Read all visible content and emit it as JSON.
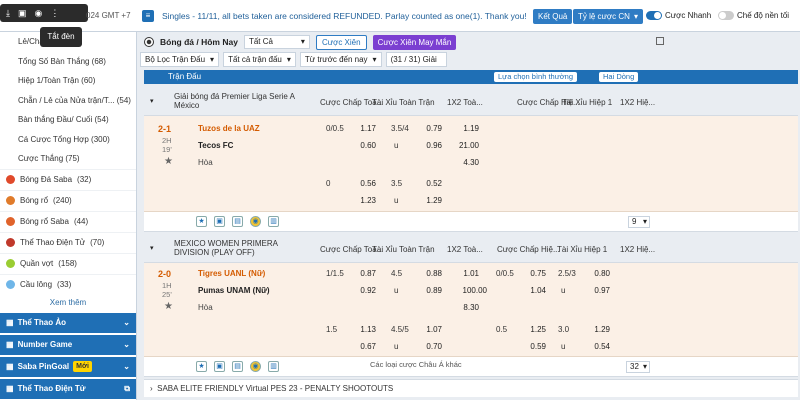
{
  "top": {
    "time": "024 GMT +7",
    "tooltip": "Tắt đèn",
    "announcement": "Singles - 11/11, all bets taken are considered REFUNDED. Parlay counted as one(1). Thank you!",
    "result_button": "Kết Quả",
    "odds_type": "Tỷ lệ cược CN",
    "quick_bet": "Cược Nhanh",
    "simple_mode": "Chế độ nền tối"
  },
  "sidebar": {
    "sub_items": [
      "Lẻ/Chẵn",
      "Tổng Số Bàn Thắng (68)",
      "Hiệp 1/Toàn Trận (60)",
      "Chẵn / Lẻ của Nửa trận/T... (54)",
      "Bàn thắng Đầu/ Cuối (54)",
      "Cá Cược Tổng Hợp (300)",
      "Cược Thắng (75)"
    ],
    "sports": [
      {
        "label": "Bóng Đá Saba",
        "count": "(32)",
        "color": "#e04a2b"
      },
      {
        "label": "Bóng rổ",
        "count": "(240)",
        "color": "#e07b2b"
      },
      {
        "label": "Bóng rổ Saba",
        "count": "(44)",
        "color": "#e0632b"
      },
      {
        "label": "Thể Thao Điện Tử",
        "count": "(70)",
        "color": "#c0392b"
      },
      {
        "label": "Quần vợt",
        "count": "(158)",
        "color": "#9acd32"
      },
      {
        "label": "Cầu lông",
        "count": "(33)",
        "color": "#6fb6e8"
      }
    ],
    "more": "Xem thêm",
    "sections": [
      "Thể Thao Ảo",
      "Number Game",
      "Saba PinGoal",
      "Thể Thao Điện Tử"
    ],
    "new_badge": "Mới"
  },
  "filters": {
    "title": "Bóng đá / Hôm Nay",
    "all": "Tất Cả",
    "single_bet": "Cược Xiên",
    "lucky_bet": "Cược Xiên May Mắn",
    "league_filter": "Bộ Lọc Trận Đấu",
    "all_matches": "Tất cả trận đấu",
    "sort": "Từ trước đến nay",
    "league_count": "(31 / 31) Giải"
  },
  "header": {
    "label": "Trận Đấu",
    "sort_option": "Lựa chọn bình thường",
    "lines": "Hai Dòng"
  },
  "columns": [
    "Cược Chấp Toà...",
    "Tài Xỉu Toàn Trận",
    "1X2 Toà...",
    "Cược Chấp Hiệ...",
    "Tài Xỉu Hiệp 1",
    "1X2 Hiệ..."
  ],
  "match1": {
    "league": "Giải bóng đá Premier Liga Serie A México",
    "score": "2-1",
    "half": "2H",
    "minute": "19'",
    "home": "Tuzos de la UAZ",
    "away": "Tecos FC",
    "draw": "Hòa",
    "rows": [
      {
        "hdp": "0/0.5",
        "hdp_h": "1.17",
        "ou": "3.5/4",
        "ou_h": "0.79",
        "x12": "1.19"
      },
      {
        "hdp_a": "0.60",
        "ou_u": "u",
        "ou_a": "0.96",
        "x12": "21.00"
      },
      {
        "x12": "4.30"
      },
      {
        "hdp": "0",
        "hdp_h": "0.56",
        "ou": "3.5",
        "ou_h": "0.52"
      },
      {
        "hdp_a": "1.23",
        "ou_u": "u",
        "ou_a": "1.29"
      }
    ],
    "count": "9"
  },
  "match2": {
    "league": "MEXICO WOMEN PRIMERA DIVISION (PLAY OFF)",
    "score": "2-0",
    "half": "1H",
    "minute": "25'",
    "home": "Tigres UANL (Nữ)",
    "away": "Pumas UNAM (Nữ)",
    "draw": "Hòa",
    "rows": [
      {
        "hdp": "1/1.5",
        "hdp_h": "0.87",
        "ou": "4.5",
        "ou_h": "0.88",
        "x12": "1.01",
        "h1_hdp": "0/0.5",
        "h1_hdp_h": "0.75",
        "h1_ou": "2.5/3",
        "h1_ou_h": "0.80"
      },
      {
        "hdp_a": "0.92",
        "ou_u": "u",
        "ou_a": "0.89",
        "x12": "100.00",
        "h1_hdp_a": "1.04",
        "h1_ou_u": "u",
        "h1_ou_a": "0.97"
      },
      {
        "x12": "8.30"
      },
      {
        "hdp": "1.5",
        "hdp_h": "1.13",
        "ou": "4.5/5",
        "ou_h": "1.07",
        "h1_hdp": "0.5",
        "h1_hdp_h": "1.25",
        "h1_ou": "3.0",
        "h1_ou_h": "1.29"
      },
      {
        "hdp_a": "0.67",
        "ou_u": "u",
        "ou_a": "0.70",
        "h1_hdp_a": "0.59",
        "h1_ou_u": "u",
        "h1_ou_a": "0.54"
      }
    ],
    "more_odds": "Các loại cược Châu Á khác",
    "count": "32"
  },
  "collapsed_league": "SABA ELITE FRIENDLY Virtual PES 23 - PENALTY SHOOTOUTS"
}
